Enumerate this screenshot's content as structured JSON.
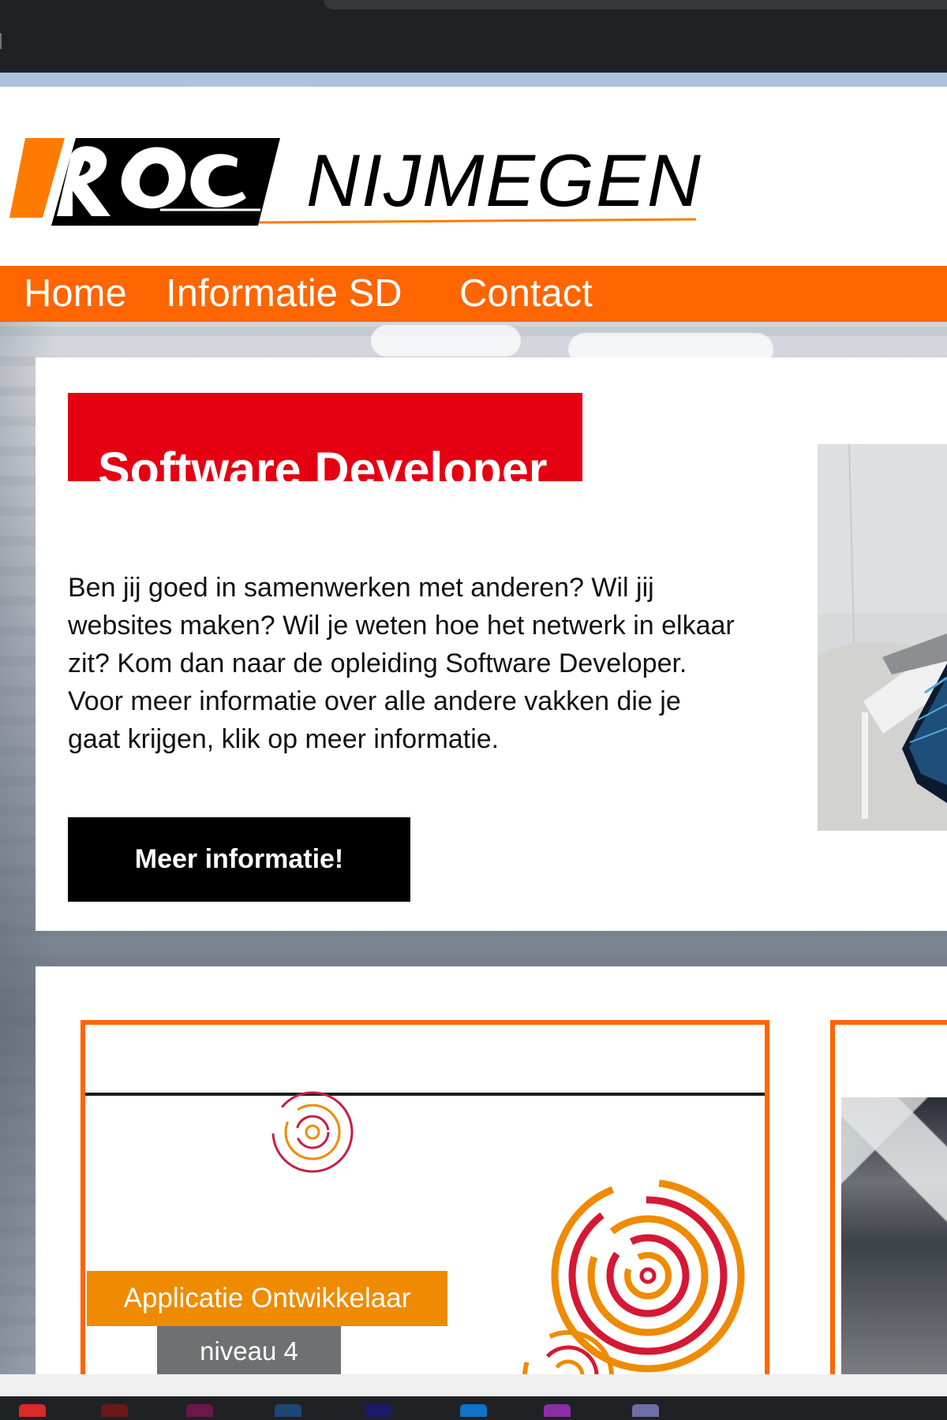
{
  "brand": {
    "roc": "ROC",
    "city": "NIJMEGEN",
    "colors": {
      "orange": "#ff6500",
      "red": "#e50012",
      "black": "#000000",
      "white": "#ffffff",
      "gray": "#6f7072"
    }
  },
  "navigation": {
    "items": [
      "Home",
      "Informatie SD",
      "Contact"
    ]
  },
  "hero": {
    "title": "Software Developer",
    "body": "Ben jij goed in samenwerken met anderen? Wil jij websites maken? Wil je weten hoe het netwerk in elkaar zit? Kom dan naar de opleiding Software Developer. Voor meer informatie over alle andere vakken die je gaat krijgen, klik op meer informatie.",
    "button": "Meer informatie!"
  },
  "courses": [
    {
      "label": "Applicatie Ontwikkelaar",
      "level": "niveau 4"
    }
  ],
  "icons": {
    "logo": "roc-nijmegen-logo",
    "course_graphic": "concentric-circles-icon",
    "hero_image": "laptop-photo",
    "course_image": "building-photo"
  }
}
